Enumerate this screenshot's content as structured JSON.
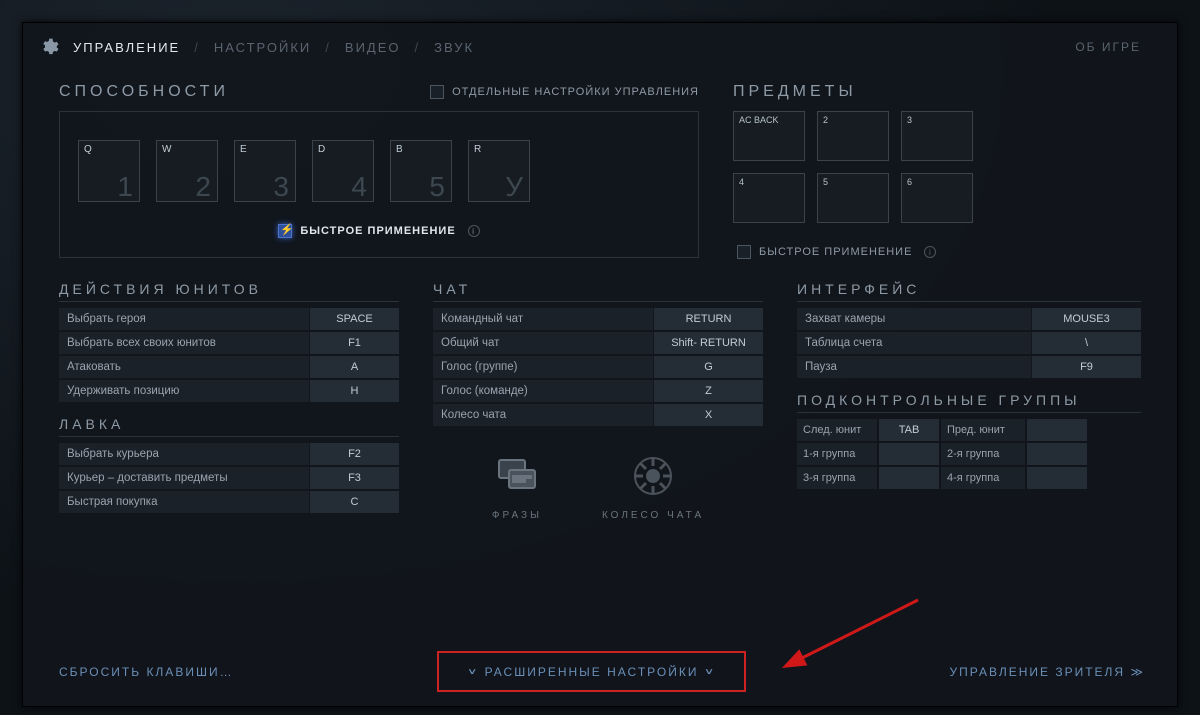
{
  "topbar": {
    "tabs": [
      "УПРАВЛЕНИЕ",
      "НАСТРОЙКИ",
      "ВИДЕО",
      "ЗВУК"
    ],
    "about": "ОБ ИГРЕ"
  },
  "abilities": {
    "title": "СПОСОБНОСТИ",
    "separate_controls": "ОТДЕЛЬНЫЕ НАСТРОЙКИ УПРАВЛЕНИЯ",
    "slots": [
      {
        "key": "Q",
        "num": "1"
      },
      {
        "key": "W",
        "num": "2"
      },
      {
        "key": "E",
        "num": "3"
      },
      {
        "key": "D",
        "num": "4"
      },
      {
        "key": "B",
        "num": "5"
      },
      {
        "key": "R",
        "num": "У"
      }
    ],
    "quickcast": "БЫСТРОЕ ПРИМЕНЕНИЕ"
  },
  "items": {
    "title": "ПРЕДМЕТЫ",
    "slots": [
      "AC BACK",
      "2",
      "3",
      "4",
      "5",
      "6"
    ],
    "quickcast": "БЫСТРОЕ ПРИМЕНЕНИЕ"
  },
  "unit": {
    "title": "ДЕЙСТВИЯ ЮНИТОВ",
    "rows": [
      {
        "label": "Выбрать героя",
        "key": "SPACE"
      },
      {
        "label": "Выбрать всех своих юнитов",
        "key": "F1"
      },
      {
        "label": "Атаковать",
        "key": "A"
      },
      {
        "label": "Удерживать позицию",
        "key": "H"
      }
    ]
  },
  "shop": {
    "title": "ЛАВКА",
    "rows": [
      {
        "label": "Выбрать курьера",
        "key": "F2"
      },
      {
        "label": "Курьер – доставить предметы",
        "key": "F3"
      },
      {
        "label": "Быстрая покупка",
        "key": "C"
      }
    ]
  },
  "chat": {
    "title": "ЧАТ",
    "rows": [
      {
        "label": "Командный чат",
        "key": "RETURN"
      },
      {
        "label": "Общий чат",
        "key": "Shift- RETURN"
      },
      {
        "label": "Голос (группе)",
        "key": "G"
      },
      {
        "label": "Голос (команде)",
        "key": "Z"
      },
      {
        "label": "Колесо чата",
        "key": "X"
      }
    ],
    "phrases": "ФРАЗЫ",
    "wheel": "КОЛЕСО ЧАТА"
  },
  "iface": {
    "title": "ИНТЕРФЕЙС",
    "rows": [
      {
        "label": "Захват камеры",
        "key": "MOUSE3"
      },
      {
        "label": "Таблица счета",
        "key": "\\"
      },
      {
        "label": "Пауза",
        "key": "F9"
      }
    ]
  },
  "groups": {
    "title": "ПОДКОНТРОЛЬНЫЕ ГРУППЫ",
    "cells": [
      {
        "t": "l",
        "v": "След. юнит"
      },
      {
        "t": "k",
        "v": "TAB"
      },
      {
        "t": "l",
        "v": "Пред. юнит"
      },
      {
        "t": "k",
        "v": ""
      },
      {
        "t": "l",
        "v": "1-я группа"
      },
      {
        "t": "k",
        "v": ""
      },
      {
        "t": "l",
        "v": "2-я группа"
      },
      {
        "t": "k",
        "v": ""
      },
      {
        "t": "l",
        "v": "3-я группа"
      },
      {
        "t": "k",
        "v": ""
      },
      {
        "t": "l",
        "v": "4-я группа"
      },
      {
        "t": "k",
        "v": ""
      }
    ]
  },
  "footer": {
    "reset": "СБРОСИТЬ КЛАВИШИ…",
    "advanced": "РАСШИРЕННЫЕ НАСТРОЙКИ",
    "spectator": "УПРАВЛЕНИЕ ЗРИТЕЛЯ"
  }
}
